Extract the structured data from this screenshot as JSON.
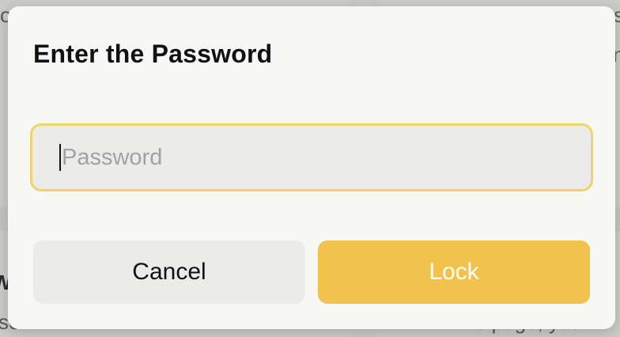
{
  "background": {
    "fragments": {
      "top_left": "o",
      "top_right": "s",
      "mid_right": "n",
      "bottom_left_bold": "W",
      "bottom_left_line": "se",
      "bottom_right_line": "e page, you"
    }
  },
  "dialog": {
    "title": "Enter the Password",
    "password_input": {
      "value": "",
      "placeholder": "Password"
    },
    "buttons": {
      "cancel_label": "Cancel",
      "lock_label": "Lock"
    }
  },
  "colors": {
    "accent": "#f2c24d",
    "focus_border": "#f0d36e",
    "dialog_background": "#f7f7f5",
    "secondary_button": "#ebebe9"
  }
}
